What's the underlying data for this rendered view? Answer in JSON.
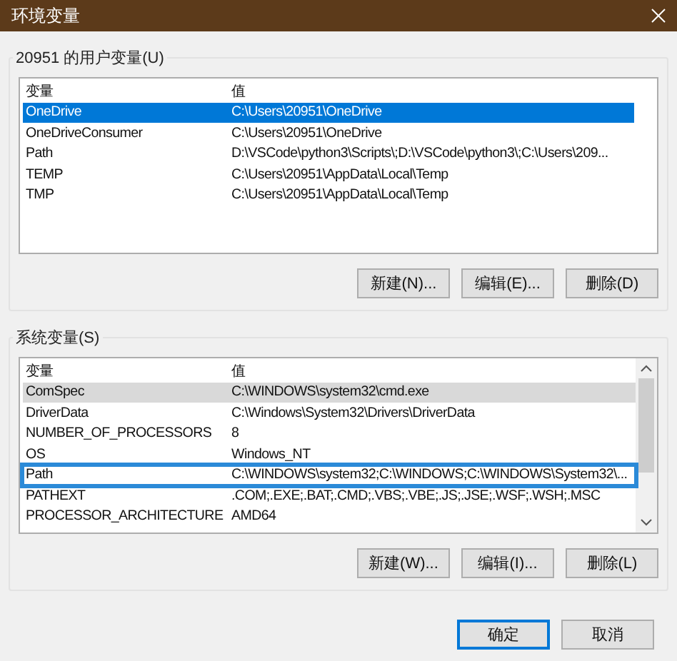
{
  "window": {
    "title": "环境变量"
  },
  "user_variables": {
    "label": "20951 的用户变量(U)",
    "focused": true,
    "columns": [
      "变量",
      "值"
    ],
    "rows": [
      {
        "name": "OneDrive",
        "value": "C:\\Users\\20951\\OneDrive",
        "selected": true
      },
      {
        "name": "OneDriveConsumer",
        "value": "C:\\Users\\20951\\OneDrive",
        "selected": false
      },
      {
        "name": "Path",
        "value": "D:\\VSCode\\python3\\Scripts\\;D:\\VSCode\\python3\\;C:\\Users\\209...",
        "selected": false
      },
      {
        "name": "TEMP",
        "value": "C:\\Users\\20951\\AppData\\Local\\Temp",
        "selected": false
      },
      {
        "name": "TMP",
        "value": "C:\\Users\\20951\\AppData\\Local\\Temp",
        "selected": false
      }
    ],
    "buttons": [
      "新建(N)...",
      "编辑(E)...",
      "删除(D)"
    ]
  },
  "system_variables": {
    "label": "系统变量(S)",
    "focused": false,
    "columns": [
      "变量",
      "值"
    ],
    "rows": [
      {
        "name": "ComSpec",
        "value": "C:\\WINDOWS\\system32\\cmd.exe",
        "selected": true,
        "outlined": false
      },
      {
        "name": "DriverData",
        "value": "C:\\Windows\\System32\\Drivers\\DriverData",
        "selected": false,
        "outlined": false
      },
      {
        "name": "NUMBER_OF_PROCESSORS",
        "value": "8",
        "selected": false,
        "outlined": false
      },
      {
        "name": "OS",
        "value": "Windows_NT",
        "selected": false,
        "outlined": false
      },
      {
        "name": "Path",
        "value": "C:\\WINDOWS\\system32;C:\\WINDOWS;C:\\WINDOWS\\System32\\...",
        "selected": false,
        "outlined": true
      },
      {
        "name": "PATHEXT",
        "value": ".COM;.EXE;.BAT;.CMD;.VBS;.VBE;.JS;.JSE;.WSF;.WSH;.MSC",
        "selected": false,
        "outlined": false
      },
      {
        "name": "PROCESSOR_ARCHITECTURE",
        "value": "AMD64",
        "selected": false,
        "outlined": false
      }
    ],
    "buttons": [
      "新建(W)...",
      "编辑(I)...",
      "删除(L)"
    ]
  },
  "footer_buttons": [
    {
      "label": "确定",
      "default": true
    },
    {
      "label": "取消",
      "default": false
    }
  ]
}
